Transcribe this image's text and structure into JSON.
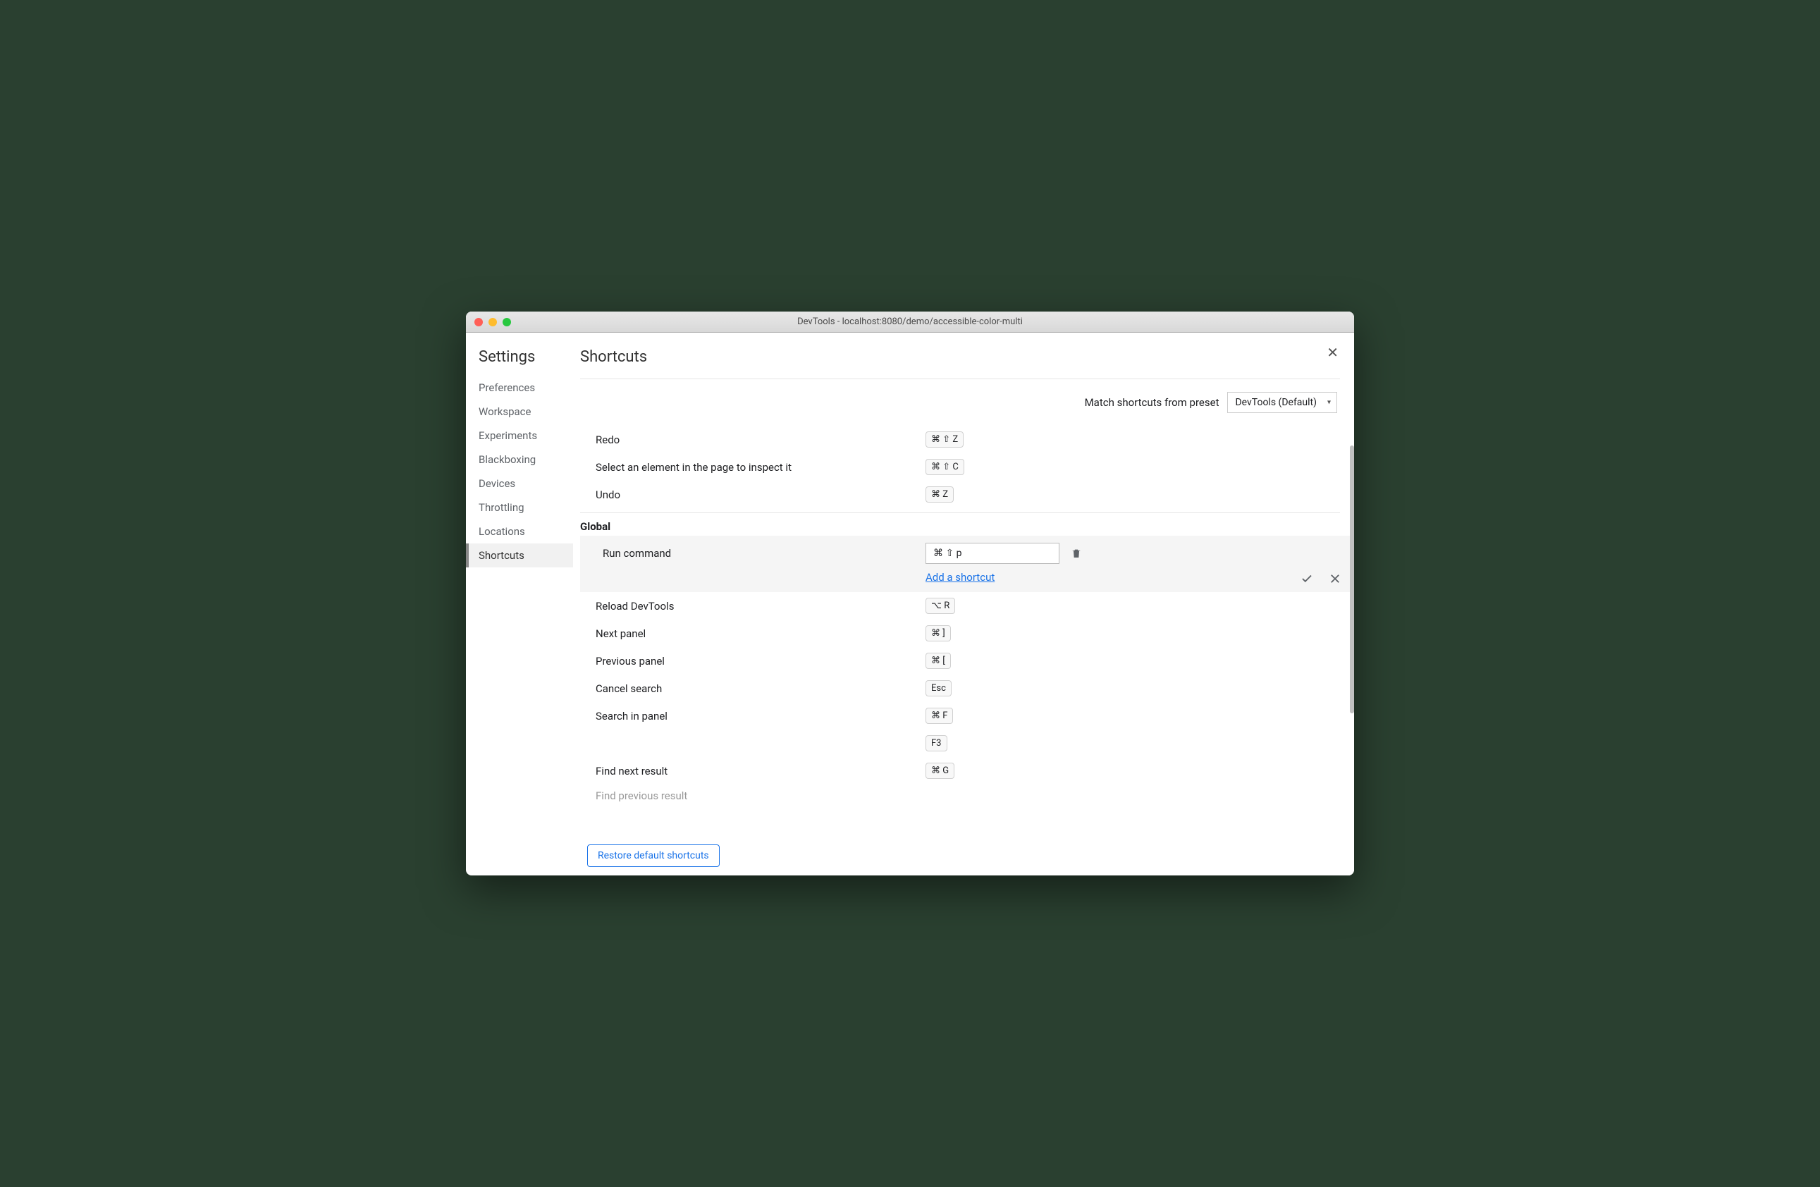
{
  "titlebar": {
    "title": "DevTools - localhost:8080/demo/accessible-color-multi"
  },
  "sidebar": {
    "title": "Settings",
    "items": [
      {
        "label": "Preferences"
      },
      {
        "label": "Workspace"
      },
      {
        "label": "Experiments"
      },
      {
        "label": "Blackboxing"
      },
      {
        "label": "Devices"
      },
      {
        "label": "Throttling"
      },
      {
        "label": "Locations"
      },
      {
        "label": "Shortcuts"
      }
    ]
  },
  "main": {
    "title": "Shortcuts",
    "presetLabel": "Match shortcuts from preset",
    "presetValue": "DevTools (Default)",
    "restore": "Restore default shortcuts",
    "topRows": [
      {
        "label": "Redo",
        "keys": [
          "⌘ ⇧ Z"
        ]
      },
      {
        "label": "Select an element in the page to inspect it",
        "keys": [
          "⌘ ⇧ C"
        ]
      },
      {
        "label": "Undo",
        "keys": [
          "⌘ Z"
        ]
      }
    ],
    "sectionTitle": "Global",
    "editRow": {
      "label": "Run command",
      "value": "⌘ ⇧ p",
      "addLink": "Add a shortcut"
    },
    "globalRows": [
      {
        "label": "Reload DevTools",
        "keys": [
          "⌥ R"
        ]
      },
      {
        "label": "Next panel",
        "keys": [
          "⌘ ]"
        ]
      },
      {
        "label": "Previous panel",
        "keys": [
          "⌘ ["
        ]
      },
      {
        "label": "Cancel search",
        "keys": [
          "Esc"
        ]
      },
      {
        "label": "Search in panel",
        "keys": [
          "⌘ F"
        ]
      },
      {
        "label": "",
        "keys": [
          "F3"
        ]
      },
      {
        "label": "Find next result",
        "keys": [
          "⌘ G"
        ]
      }
    ],
    "partialRow": {
      "label": "Find previous result"
    }
  }
}
